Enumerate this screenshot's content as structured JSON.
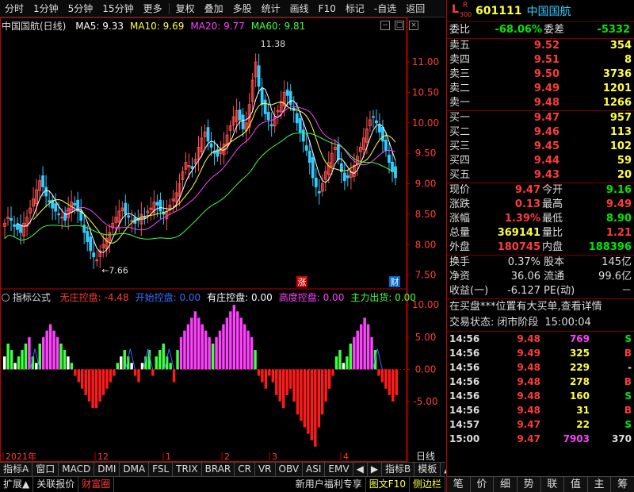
{
  "toolbar": {
    "period_tabs": [
      "分时",
      "1分钟",
      "5分钟",
      "15分钟",
      "更多"
    ],
    "actions": [
      "复权",
      "叠加",
      "多股",
      "统计",
      "画线",
      "F10",
      "标记",
      "-自选",
      "返回"
    ]
  },
  "chart": {
    "stock_label": "中国国航(日线)",
    "ma": [
      {
        "label": "MA5: 9.33",
        "color": "#ffffff"
      },
      {
        "label": "MA10: 9.69",
        "color": "#ffff40"
      },
      {
        "label": "MA20: 9.77",
        "color": "#ff40ff"
      },
      {
        "label": "MA60: 9.81",
        "color": "#40ff40"
      }
    ],
    "high_label": "11.38",
    "low_label": "7.66",
    "badge_zhang": "涨",
    "badge_cai": "财",
    "month_labels": [
      "2021年",
      "12",
      "1",
      "2",
      "3",
      "4"
    ],
    "period_label": "日线"
  },
  "chart_data": [
    {
      "type": "candlestick",
      "title": "中国国航(日线)",
      "y_ticks": [
        11.0,
        10.5,
        10.0,
        9.5,
        9.0,
        8.5,
        8.0,
        7.5
      ],
      "ylim": [
        7.3,
        11.6
      ],
      "x_months": [
        "2021年",
        "12",
        "1",
        "2",
        "3",
        "4"
      ],
      "series": [
        {
          "name": "MA5",
          "last": 9.33
        },
        {
          "name": "MA10",
          "last": 9.69
        },
        {
          "name": "MA20",
          "last": 9.77
        },
        {
          "name": "MA60",
          "last": 9.81
        }
      ],
      "closes": [
        8.35,
        8.45,
        8.4,
        8.3,
        8.25,
        8.2,
        8.35,
        8.45,
        8.6,
        8.75,
        8.9,
        9.05,
        8.95,
        8.8,
        8.7,
        8.6,
        8.55,
        8.5,
        8.45,
        8.4,
        8.6,
        8.7,
        8.65,
        8.55,
        8.4,
        8.2,
        8.05,
        7.9,
        7.8,
        7.75,
        7.9,
        8.0,
        8.1,
        8.2,
        8.35,
        8.45,
        8.55,
        8.6,
        8.5,
        8.45,
        8.4,
        8.35,
        8.4,
        8.5,
        8.45,
        8.55,
        8.6,
        8.7,
        8.65,
        8.55,
        8.5,
        8.55,
        8.65,
        8.75,
        8.85,
        9.0,
        9.2,
        9.35,
        9.3,
        9.25,
        9.4,
        9.6,
        9.75,
        9.85,
        9.7,
        9.6,
        9.5,
        9.45,
        9.55,
        9.65,
        9.8,
        9.95,
        10.1,
        10.2,
        10.05,
        9.9,
        10.0,
        10.3,
        10.7,
        11.0,
        10.6,
        10.3,
        10.15,
        10.05,
        9.95,
        10.1,
        10.2,
        10.35,
        10.5,
        10.45,
        10.3,
        10.2,
        10.0,
        9.85,
        9.7,
        9.55,
        9.35,
        9.1,
        8.95,
        8.85,
        9.0,
        9.2,
        9.35,
        9.5,
        9.6,
        9.4,
        9.2,
        9.05,
        9.1,
        9.2,
        9.3,
        9.45,
        9.6,
        9.75,
        9.9,
        10.05,
        10.1,
        10.0,
        9.85,
        9.7,
        9.55,
        9.35,
        9.2,
        9.1
      ],
      "ma5_last": 9.33
    },
    {
      "type": "bar",
      "title": "指标公式",
      "series": [
        {
          "name": "无庄控盘",
          "value": -4.48
        },
        {
          "name": "开始控盘",
          "value": 0.0
        },
        {
          "name": "有庄控盘",
          "value": 0.0
        },
        {
          "name": "高度控盘",
          "value": 0.0
        },
        {
          "name": "主力出货",
          "value": 0.0
        }
      ],
      "y_ticks": [
        10.0,
        5.0,
        0.0,
        -5.0
      ],
      "ylim": [
        -12.5,
        11.5
      ],
      "values": [
        2,
        4,
        3,
        1,
        2,
        3,
        4,
        5,
        2,
        1,
        4,
        5,
        6,
        7,
        6,
        5,
        4,
        3,
        2,
        1,
        -1,
        -2,
        -3,
        -4,
        -5,
        -6,
        -6,
        -5,
        -4,
        -3,
        -2,
        -1,
        1,
        2,
        3,
        2,
        1,
        -1,
        -2,
        1,
        2,
        3,
        -1,
        2,
        3,
        4,
        2,
        1,
        -2,
        3,
        5,
        6,
        7,
        8,
        9,
        8,
        7,
        6,
        5,
        4,
        5,
        6,
        7,
        8,
        9,
        10,
        9,
        8,
        7,
        6,
        5,
        3,
        -1,
        -2,
        -3,
        -1,
        -2,
        -4,
        -5,
        -6,
        -4,
        -3,
        -5,
        -7,
        -8,
        -9,
        -10,
        -11,
        -12,
        -9,
        -7,
        -5,
        -3,
        -1,
        2,
        3,
        1,
        2,
        4,
        5,
        6,
        7,
        8,
        7,
        5,
        3,
        -1,
        -2,
        -3,
        -4,
        -5,
        -4
      ],
      "category_keys": [
        "开始控盘",
        "有庄控盘",
        "高度控盘",
        "主力出货"
      ]
    }
  ],
  "indicator": {
    "title": "指标公式",
    "items": [
      {
        "label": "无庄控盘: -4.48",
        "color": "#ff3b3b"
      },
      {
        "label": "开始控盘: 0.00",
        "color": "#3c6cff"
      },
      {
        "label": "有庄控盘: 0.00",
        "color": "#ffffff"
      },
      {
        "label": "高度控盘: 0.00",
        "color": "#ff40ff"
      },
      {
        "label": "主力出货: 0.00",
        "color": "#40ff40"
      }
    ]
  },
  "bottom_tabs": [
    "指标A",
    "窗口",
    "MACD",
    "DMI",
    "DMA",
    "FSL",
    "TRIX",
    "BRAR",
    "CR",
    "VR",
    "OBV",
    "ASI",
    "EMV",
    "◀",
    "▶",
    "指标B",
    "模板",
    "▲"
  ],
  "status_tabs": [
    "扩展▲",
    "关联报价",
    "财富圈",
    "新用户福利专享",
    "图文F10",
    "侧边栏"
  ],
  "quote": {
    "code": "601111",
    "name": "中国国航",
    "flag_top": "L",
    "flag_r": "R",
    "flag_num": "300",
    "weibi_label": "委比",
    "weibi_value": "-68.06%",
    "weicha_label": "委差",
    "weicha_value": "-5332",
    "sell": [
      {
        "label": "卖五",
        "price": "9.52",
        "vol": "354"
      },
      {
        "label": "卖四",
        "price": "9.51",
        "vol": "8"
      },
      {
        "label": "卖三",
        "price": "9.50",
        "vol": "3736"
      },
      {
        "label": "卖二",
        "price": "9.49",
        "vol": "1201"
      },
      {
        "label": "卖一",
        "price": "9.48",
        "vol": "1266"
      }
    ],
    "buy": [
      {
        "label": "买一",
        "price": "9.47",
        "vol": "957"
      },
      {
        "label": "买二",
        "price": "9.46",
        "vol": "113"
      },
      {
        "label": "买三",
        "price": "9.45",
        "vol": "102"
      },
      {
        "label": "买四",
        "price": "9.44",
        "vol": "59"
      },
      {
        "label": "买五",
        "price": "9.43",
        "vol": "20"
      }
    ],
    "stats": [
      {
        "l1": "现价",
        "v1": "9.47",
        "c1": "red",
        "l2": "今开",
        "v2": "9.16",
        "c2": "grn"
      },
      {
        "l1": "涨跌",
        "v1": "0.13",
        "c1": "red",
        "l2": "最高",
        "v2": "9.49",
        "c2": "red"
      },
      {
        "l1": "涨幅",
        "v1": "1.39%",
        "c1": "red",
        "l2": "最低",
        "v2": "8.90",
        "c2": "grn"
      },
      {
        "l1": "总量",
        "v1": "369141",
        "c1": "yel",
        "l2": "量比",
        "v2": "1.21",
        "c2": "red"
      },
      {
        "l1": "外盘",
        "v1": "180745",
        "c1": "red",
        "l2": "内盘",
        "v2": "188396",
        "c2": "grn"
      }
    ],
    "stats2": [
      {
        "l1": "换手",
        "v1": "0.37%",
        "l2": "股本",
        "v2": "145亿"
      },
      {
        "l1": "净资",
        "v1": "36.06",
        "l2": "流通",
        "v2": "99.6亿"
      },
      {
        "l1": "收益(一)",
        "v1": "-6.127",
        "l2": "PE(动)",
        "v2": "－"
      }
    ],
    "notice": "在买盘***位置有大买单,查看详情",
    "trade_status_label": "交易状态:",
    "trade_status_value": "闭市阶段",
    "trade_status_time": "15:00:04",
    "ticks": [
      {
        "time": "14:56",
        "price": "9.48",
        "pc": "red",
        "vol": "769",
        "vc": "mag",
        "side": "S",
        "sc": "grn"
      },
      {
        "time": "14:56",
        "price": "9.49",
        "pc": "red",
        "vol": "325",
        "vc": "yel",
        "side": "B",
        "sc": "red"
      },
      {
        "time": "14:56",
        "price": "9.48",
        "pc": "red",
        "vol": "229",
        "vc": "yel",
        "side": "-",
        "sc": "wht"
      },
      {
        "time": "14:56",
        "price": "9.48",
        "pc": "red",
        "vol": "278",
        "vc": "yel",
        "side": "B",
        "sc": "red"
      },
      {
        "time": "14:56",
        "price": "9.48",
        "pc": "red",
        "vol": "160",
        "vc": "yel",
        "side": "S",
        "sc": "grn"
      },
      {
        "time": "14:56",
        "price": "9.48",
        "pc": "red",
        "vol": "31",
        "vc": "yel",
        "side": "B",
        "sc": "red"
      },
      {
        "time": "14:57",
        "price": "9.47",
        "pc": "red",
        "vol": "22",
        "vc": "yel",
        "side": "S",
        "sc": "grn"
      },
      {
        "time": "15:00",
        "price": "9.47",
        "pc": "red",
        "vol": "7903",
        "vc": "mag",
        "side": "370",
        "sc": "wht"
      }
    ],
    "bottom_tabs": [
      "笔",
      "价",
      "细",
      "势",
      "联",
      "值",
      "主",
      "筹"
    ]
  }
}
